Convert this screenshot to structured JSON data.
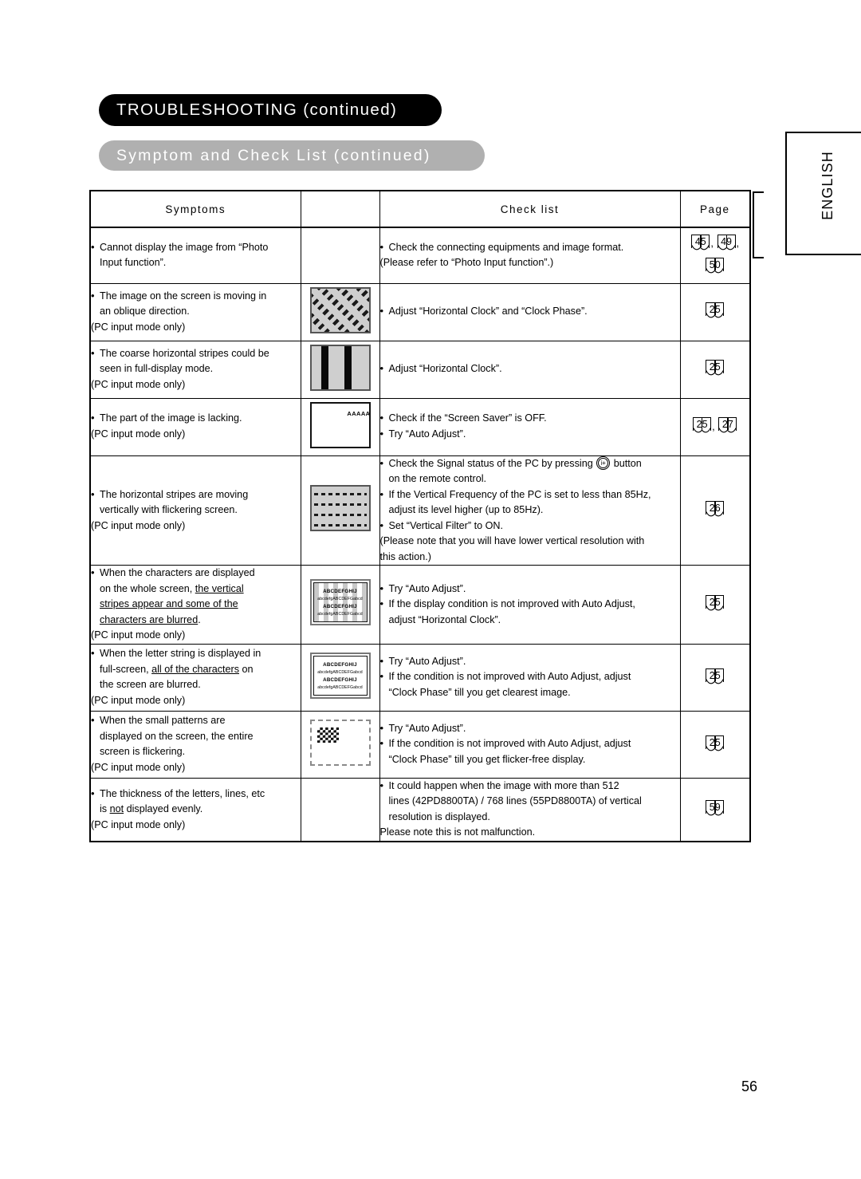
{
  "header": {
    "main_title": "TROUBLESHOOTING (continued)",
    "sub_title": "Symptom and Check List (continued)"
  },
  "side_tab": {
    "label": "ENGLISH"
  },
  "footer": {
    "page_number": "56"
  },
  "table": {
    "columns": {
      "symptoms": "Symptoms",
      "image": "",
      "check_list": "Check list",
      "page": "Page"
    },
    "rows": [
      {
        "symptom_lines": [
          "Cannot display the image from “Photo",
          "Input function”."
        ],
        "note": "",
        "thumb": "none",
        "check_lines": [
          "Check the connecting equipments and image format.",
          "(Please refer to “Photo Input function”.)"
        ],
        "pages": [
          "45",
          "49",
          "50"
        ]
      },
      {
        "symptom_lines": [
          "The image on the screen is moving in",
          "an oblique direction."
        ],
        "note": "(PC input mode only)",
        "thumb": "oblique-stripes-thumbnail",
        "check_lines": [
          "Adjust “Horizontal Clock” and “Clock Phase”."
        ],
        "pages": [
          "25"
        ]
      },
      {
        "symptom_lines": [
          "The coarse horizontal stripes could be",
          "seen in full-display mode."
        ],
        "note": "(PC input mode only)",
        "thumb": "vertical-bars-thumbnail",
        "check_lines": [
          "Adjust “Horizontal Clock”."
        ],
        "pages": [
          "25"
        ]
      },
      {
        "symptom_lines": [
          "The part of the image is lacking."
        ],
        "note": "(PC input mode only)",
        "thumb": "blank-screen-aaaa-thumbnail",
        "thumb_text": "AAAAA",
        "check_lines": [
          "Check if the “Screen Saver” is OFF.",
          "Try “Auto Adjust”."
        ],
        "pages": [
          "25",
          "27"
        ]
      },
      {
        "symptom_lines": [
          "The horizontal stripes are moving",
          "vertically with flickering screen."
        ],
        "note": "(PC input mode only)",
        "thumb": "horizontal-dashed-lines-thumbnail",
        "check_lines": [
          "Check the Signal status of the PC by pressing",
          "on the remote control.",
          "If the Vertical Frequency of the PC is set to less than 85Hz,",
          "adjust its level higher (up to 85Hz).",
          "Set “Vertical Filter” to ON.",
          "(Please note that you will have lower vertical resolution with",
          "this action.)"
        ],
        "button_word_before": "Check the Signal status of the PC by pressing",
        "button_word_after": "button",
        "button_icon_label": "i+",
        "pages": [
          "26"
        ]
      },
      {
        "symptom_lines": [
          "When the characters are displayed",
          "on the whole screen, ",
          "the vertical ",
          "stripes appear and some of the ",
          "characters are blurred",
          "."
        ],
        "note": "(PC input mode only)",
        "thumb": "blurred-characters-striped-thumbnail",
        "thumb_lines": [
          "ABCDEFGHIJ",
          "abcdefgABCDEFGabcd",
          "ABCDEFGHIJ",
          "abcdefgABCDEFGabcd"
        ],
        "check_lines": [
          "Try “Auto Adjust”.",
          "If the display condition is not improved with Auto Adjust,",
          "adjust “Horizontal Clock”."
        ],
        "pages": [
          "25"
        ]
      },
      {
        "symptom_lines": [
          "When the letter string is displayed in",
          "full-screen, ",
          "all of the characters",
          " on",
          "the screen are blurred."
        ],
        "note": "(PC input mode only)",
        "thumb": "blurred-characters-thumbnail",
        "thumb_lines": [
          "ABCDEFGHIJ",
          "abcdefgABCDEFGabcd",
          "ABCDEFGHIJ",
          "abcdefgABCDEFGabcd"
        ],
        "check_lines": [
          "Try “Auto Adjust”.",
          "If the condition is not improved with Auto Adjust, adjust",
          "“Clock Phase” till you get clearest image."
        ],
        "pages": [
          "25"
        ]
      },
      {
        "symptom_lines": [
          "When the small patterns are",
          "displayed on the screen, the entire",
          "screen is flickering."
        ],
        "note": "(PC input mode only)",
        "thumb": "checkerboard-pattern-thumbnail",
        "check_lines": [
          "Try “Auto Adjust”.",
          "If the condition is not improved with Auto Adjust, adjust",
          "“Clock Phase” till you get flicker-free display."
        ],
        "pages": [
          "25"
        ]
      },
      {
        "symptom_lines": [
          "The thickness of the letters, lines, etc",
          "is ",
          "not",
          " displayed evenly."
        ],
        "note": "(PC input mode only)",
        "thumb": "none",
        "check_lines": [
          "It could happen when the image with more than 512",
          "lines (42PD8800TA) / 768 lines (55PD8800TA) of vertical",
          "resolution is displayed.",
          "Please note this is not malfunction."
        ],
        "pages": [
          "59"
        ]
      }
    ]
  }
}
